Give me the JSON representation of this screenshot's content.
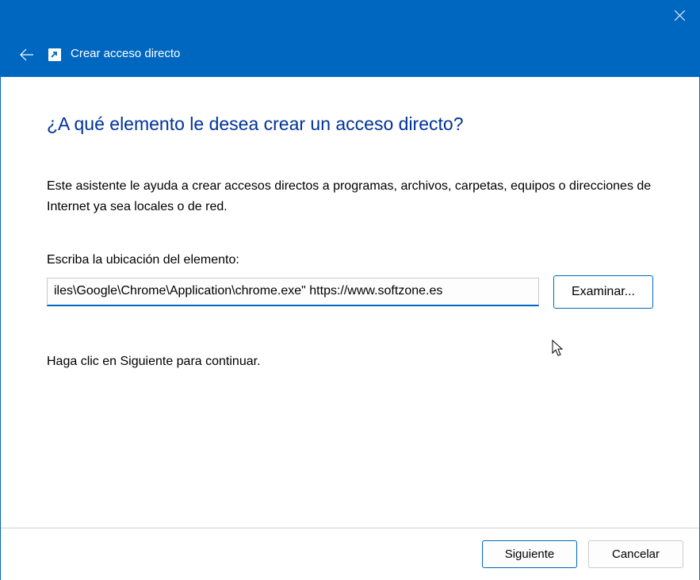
{
  "titlebar": {
    "window_title": "Crear acceso directo"
  },
  "main": {
    "heading": "¿A qué elemento le desea crear un acceso directo?",
    "description": "Este asistente le ayuda a crear accesos directos a programas, archivos, carpetas, equipos o direcciones de Internet ya sea locales o de red.",
    "field_label": "Escriba la ubicación del elemento:",
    "location_value": "iles\\Google\\Chrome\\Application\\chrome.exe\" https://www.softzone.es",
    "browse_label": "Examinar...",
    "continue_text": "Haga clic en Siguiente para continuar."
  },
  "footer": {
    "next_label": "Siguiente",
    "cancel_label": "Cancelar"
  }
}
